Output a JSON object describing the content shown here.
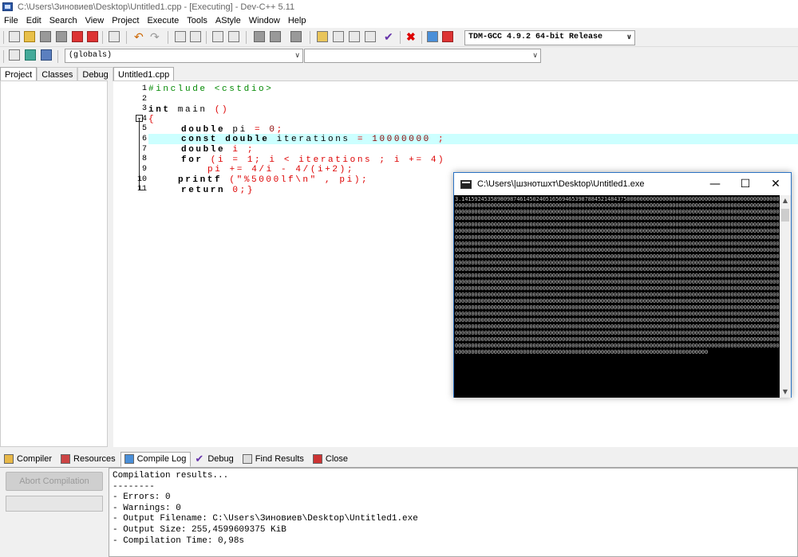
{
  "window": {
    "title": "C:\\Users\\Зиновиев\\Desktop\\Untitled1.cpp - [Executing] - Dev-C++ 5.11"
  },
  "menu": [
    "File",
    "Edit",
    "Search",
    "View",
    "Project",
    "Execute",
    "Tools",
    "AStyle",
    "Window",
    "Help"
  ],
  "toolbar": {
    "compiler_select": "TDM-GCC 4.9.2 64-bit Release",
    "scope_select": "(globals)",
    "member_select": ""
  },
  "left_tabs": [
    "Project",
    "Classes",
    "Debug"
  ],
  "editor": {
    "tab": "Untitled1.cpp",
    "line_numbers": [
      "1",
      "2",
      "3",
      "4",
      "5",
      "6",
      "7",
      "8",
      "9",
      "10",
      "11"
    ],
    "lines": {
      "l1_pp": "#include <cstdio>",
      "l3_kw": "int",
      "l3_rest": " main ",
      "l3_paren": "()",
      "l4": "{",
      "l5_kw": "double",
      "l5_rest": " pi ",
      "l5_op": "=",
      "l5_num": " 0",
      "l5_end": ";",
      "l6_kw": "const double",
      "l6_rest": " iterations ",
      "l6_op": "=",
      "l6_num": " 10000000",
      "l6_end": " ;",
      "l7_kw": "double",
      "l7_rest": " i ;",
      "l8_kw": "for",
      "l8_rest": " (i = 1; i < iterations ; i += 4)",
      "l9": "pi += 4/i - 4/(i+2);",
      "l10_fn": "printf",
      "l10_rest": " (\"%5000lf\\n\" , pi);",
      "l11_kw": "return",
      "l11_rest": " 0;}"
    }
  },
  "bottom_tabs": [
    "Compiler",
    "Resources",
    "Compile Log",
    "Debug",
    "Find Results",
    "Close"
  ],
  "abort_button": "Abort Compilation",
  "compile_log": [
    "Compilation results...",
    "--------",
    "- Errors: 0",
    "- Warnings: 0",
    "- Output Filename: C:\\Users\\Зиновиев\\Desktop\\Untitled1.exe",
    "- Output Size: 255,4599609375 KiB",
    "- Compilation Time: 0,98s"
  ],
  "console": {
    "title": "C:\\Users\\|шзнотшхт\\Desktop\\Untitled1.exe",
    "minimize": "—",
    "maximize": "☐",
    "close": "✕",
    "first_value": "3.1415924535898098746145024051656946539878845214843750000000000000000000000000",
    "fill_digit": "0"
  },
  "colors": {
    "highlight_line": "#ccffff",
    "console_bg": "#000000",
    "console_border": "#2b73c4"
  }
}
